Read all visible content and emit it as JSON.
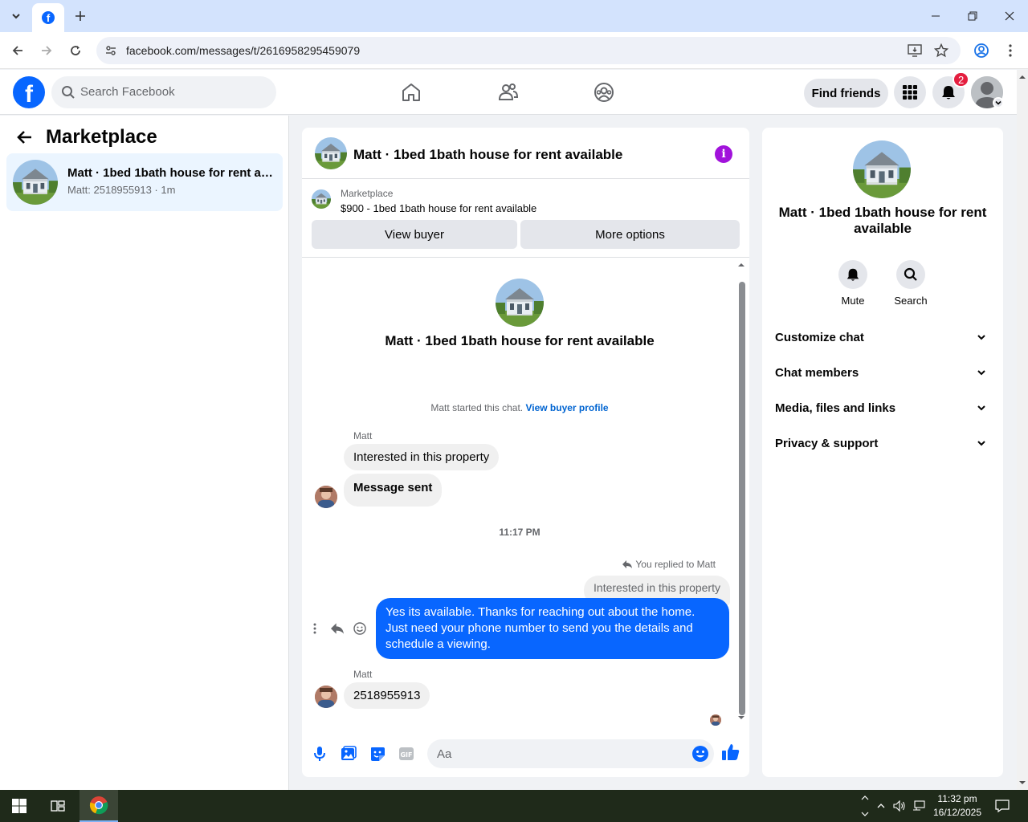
{
  "browser": {
    "url": "facebook.com/messages/t/2616958295459079"
  },
  "fbnav": {
    "search_placeholder": "Search Facebook",
    "find_friends": "Find friends",
    "notif_count": "2",
    "logo_letter": "f"
  },
  "left": {
    "title": "Marketplace",
    "conversation": {
      "name": "Matt · 1bed 1bath house for rent available",
      "sub": "Matt: 2518955913 · 1m"
    }
  },
  "chat": {
    "title": "Matt · 1bed 1bath house for rent available",
    "listing_category": "Marketplace",
    "listing_title": "$900 - 1bed 1bath house for rent available",
    "view_buyer": "View buyer",
    "more_options": "More options",
    "intro_title": "Matt · 1bed 1bath house for rent available",
    "started_text": "Matt started this chat.",
    "started_link": "View buyer profile",
    "sender1": "Matt",
    "msg1": "Interested in this property",
    "msg2": "Message sent",
    "timestamp": "11:17 PM",
    "replied_to": "You replied to Matt",
    "quoted": "Interested in this property",
    "reply": "Yes its available. Thanks for reaching out about the home. Just need your phone number to send you the details and schedule a viewing.",
    "sender2": "Matt",
    "msg3": "2518955913",
    "composer_placeholder": "Aa"
  },
  "right": {
    "title": "Matt · 1bed 1bath house for rent available",
    "mute": "Mute",
    "search": "Search",
    "rows": [
      "Customize chat",
      "Chat members",
      "Media, files and links",
      "Privacy & support"
    ]
  },
  "taskbar": {
    "time": "11:32 pm",
    "date": "16/12/2025"
  },
  "colors": {
    "fb_blue": "#0866ff",
    "info_purple": "#a112db",
    "badge_red": "#e41e3f"
  }
}
